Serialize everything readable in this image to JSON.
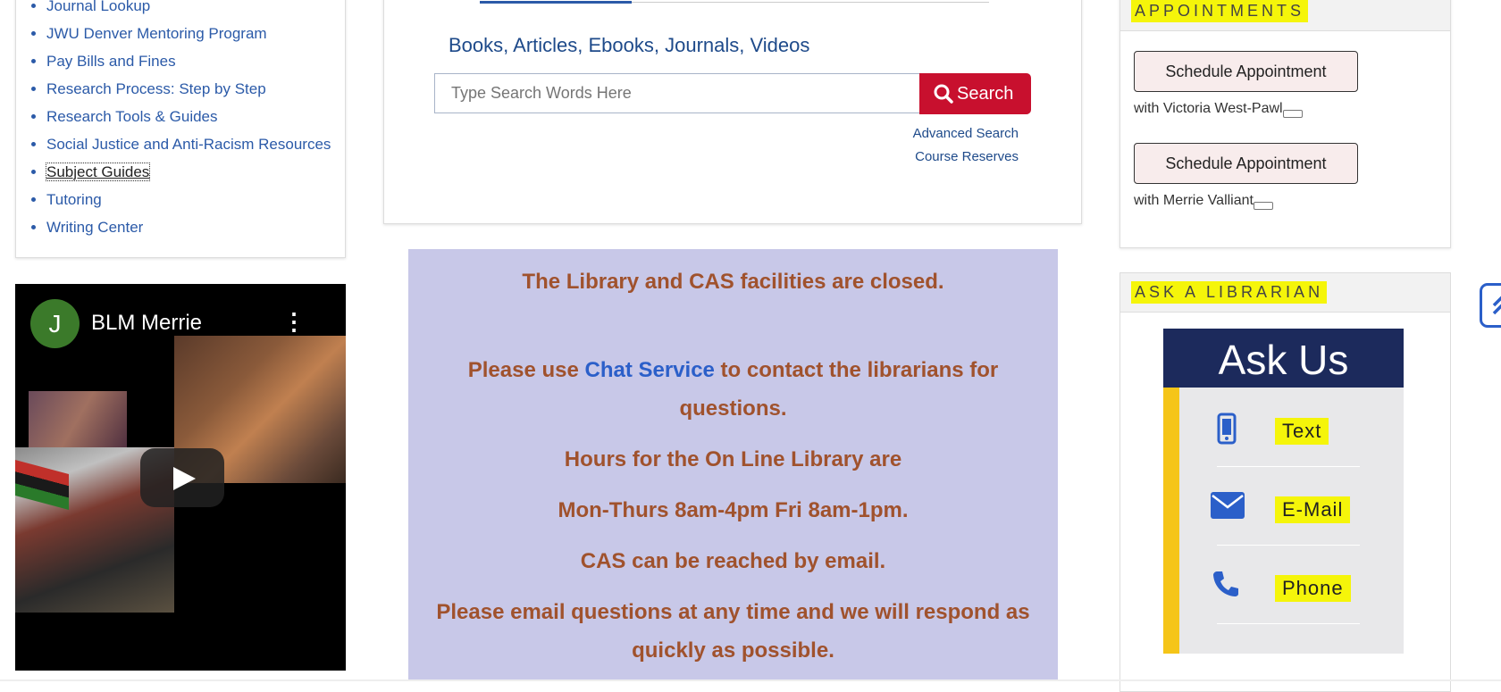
{
  "left_nav": {
    "items": [
      {
        "label": "Journal Lookup"
      },
      {
        "label": "JWU Denver Mentoring Program"
      },
      {
        "label": "Pay Bills and Fines"
      },
      {
        "label": "Research Process: Step by Step"
      },
      {
        "label": "Research Tools & Guides"
      },
      {
        "label": "Social Justice and Anti-Racism Resources"
      },
      {
        "label": "Subject Guides"
      },
      {
        "label": "Tutoring"
      },
      {
        "label": "Writing Center"
      }
    ]
  },
  "video": {
    "avatar_letter": "J",
    "title": "BLM Merrie",
    "menu_icon": "more-vert-icon",
    "play_icon": "play-icon"
  },
  "search": {
    "heading": "Books, Articles, Ebooks, Journals, Videos",
    "placeholder": "Type Search Words Here",
    "button_label": "Search",
    "advanced_link": "Advanced Search",
    "reserves_link": "Course Reserves",
    "accent_color": "#c8102e"
  },
  "notice": {
    "line1": "The Library and CAS facilities are closed.",
    "line2_pre": "Please use ",
    "line2_link": "Chat Service",
    "line2_post": " to contact the librarians for",
    "line3": "questions.",
    "line4": "Hours for the On Line Library are",
    "line5": "Mon-Thurs 8am-4pm Fri 8am-1pm.",
    "line6": "CAS can be reached by email.",
    "line7": "Please email questions at any time and we will respond as",
    "line8": "quickly as possible.",
    "background_color": "#c8c8e8",
    "text_color": "#a0522d"
  },
  "appointments": {
    "heading": "APPOINTMENTS",
    "items": [
      {
        "button": "Schedule Appointment",
        "with": "with Victoria West-Pawl"
      },
      {
        "button": "Schedule Appointment",
        "with": "with Merrie Valliant"
      }
    ]
  },
  "ask_librarian": {
    "heading": "ASK A LIBRARIAN",
    "widget_title": "Ask Us",
    "options": [
      {
        "label": "Text",
        "icon": "mobile-phone-icon"
      },
      {
        "label": "E-Mail",
        "icon": "envelope-icon"
      },
      {
        "label": "Phone",
        "icon": "phone-icon"
      }
    ],
    "header_color": "#1c2a5c",
    "accent_color": "#f5c518"
  },
  "back_to_top": {
    "icon": "double-chevron-up-icon"
  }
}
